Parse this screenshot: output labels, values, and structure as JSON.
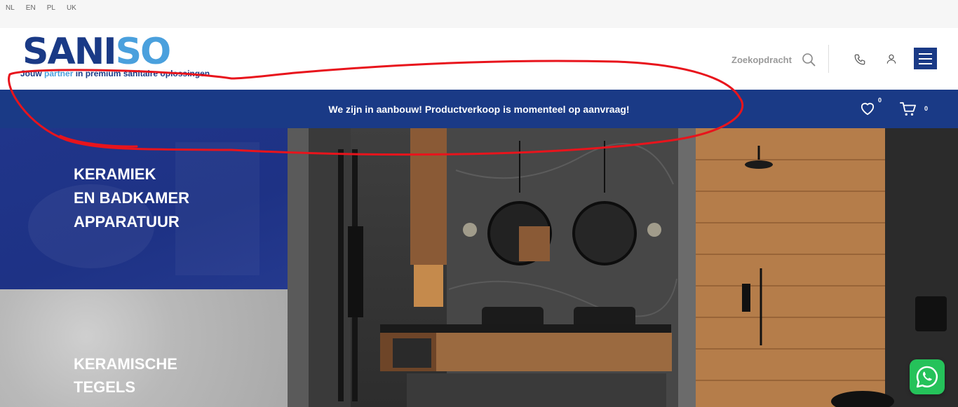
{
  "languages": [
    "NL",
    "EN",
    "PL",
    "UK"
  ],
  "brand": {
    "logo_part1": "SANI",
    "logo_part2": "SO",
    "tagline_start": "Jouw",
    "tagline_accent": "partner",
    "tagline_end": "in premium sanitaire oplossingen",
    "primary_color": "#1a3a86",
    "accent_color": "#4aa0dd"
  },
  "header": {
    "search_label": "Zoekopdracht",
    "icons": [
      "search-icon",
      "phone-icon",
      "user-icon",
      "hamburger-menu-icon"
    ]
  },
  "notice": {
    "text": "We zijn in aanbouw! Productverkoop is momenteel op aanvraag!",
    "wishlist_count": "0",
    "cart_count": "0"
  },
  "tiles": [
    {
      "line1": "KERAMIEK",
      "line2": "EN BADKAMER",
      "line3": "APPARATUUR"
    },
    {
      "line1": "KERAMISCHE",
      "line2": "TEGELS"
    }
  ],
  "annotation_color": "#e8141c",
  "whatsapp_icon": "whatsapp-icon"
}
